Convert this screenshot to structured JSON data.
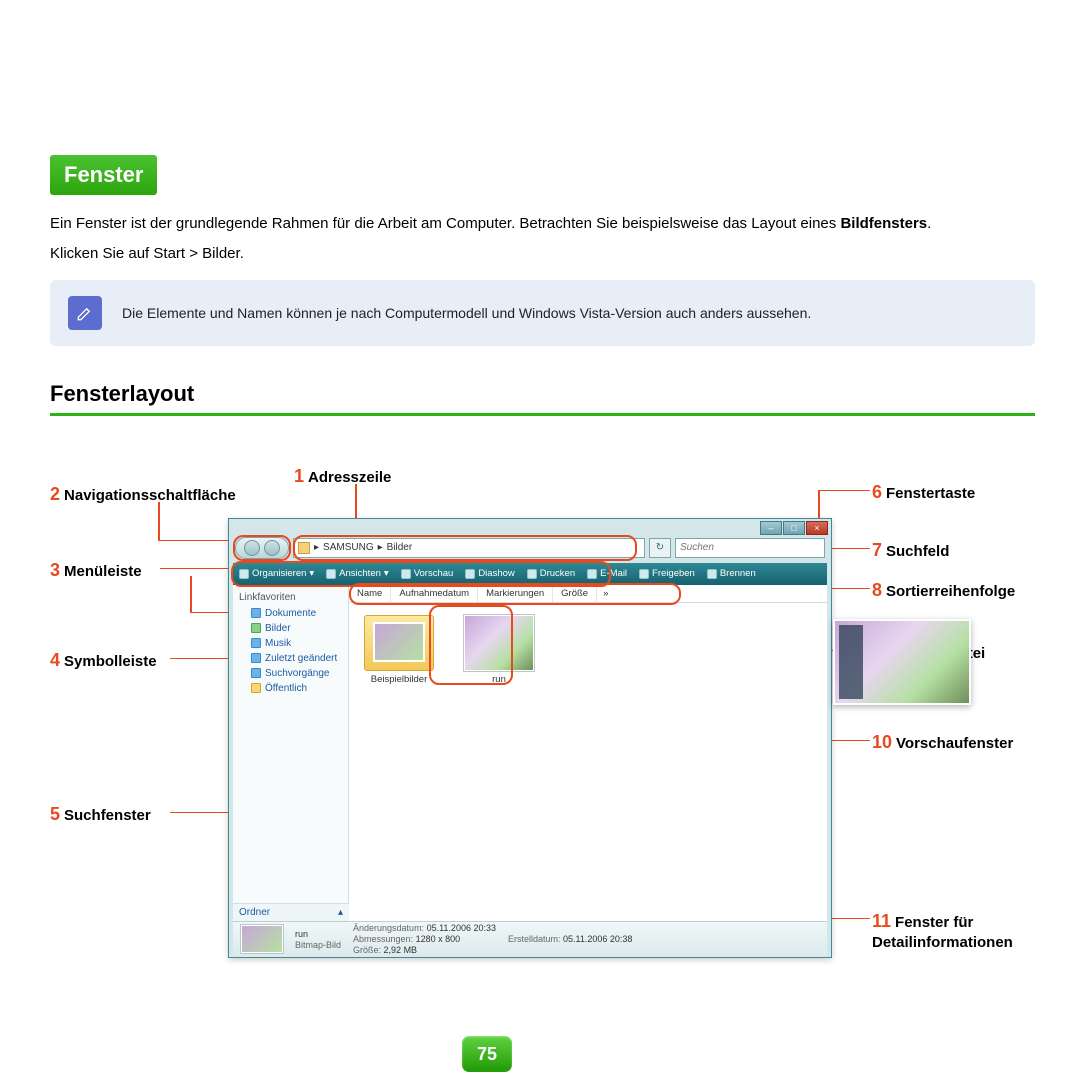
{
  "header": {
    "title": "Fenster"
  },
  "intro": {
    "line1a": "Ein Fenster ist der grundlegende Rahmen für die Arbeit am Computer. Betrachten Sie beispielsweise das Layout eines ",
    "line1b": "Bildfensters",
    "line1c": ".",
    "instruction_pre": "Klicken Sie auf ",
    "instruction_bold": "Start > Bilder",
    "instruction_post": "."
  },
  "note": "Die Elemente und Namen können je nach Computermodell und Windows Vista-Version auch anders aussehen.",
  "section_title": "Fensterlayout",
  "callouts": {
    "1": "Adresszeile",
    "2": "Navigationsschaltfläche",
    "3": "Menüleiste",
    "4": "Symbolleiste",
    "5": "Suchfenster",
    "6": "Fenstertaste",
    "7": "Suchfeld",
    "8": "Sortierreihenfolge",
    "9": "Ordner / Datei",
    "10": "Vorschaufenster",
    "11a": "Fenster für",
    "11b": "Detailinformationen"
  },
  "window": {
    "address": {
      "seg1": "SAMSUNG",
      "seg2": "Bilder",
      "sep": "▸"
    },
    "search_placeholder": "Suchen",
    "toolbar": [
      "Organisieren",
      "Ansichten",
      "Vorschau",
      "Diashow",
      "Drucken",
      "E-Mail",
      "Freigeben",
      "Brennen"
    ],
    "nav_head": "Linkfavoriten",
    "nav_items": [
      "Dokumente",
      "Bilder",
      "Musik",
      "Zuletzt geändert",
      "Suchvorgänge",
      "Öffentlich"
    ],
    "folders_label": "Ordner",
    "folders_caret": "▴",
    "sort_cols": [
      "Name",
      "Aufnahmedatum",
      "Markierungen",
      "Größe"
    ],
    "sort_more": "»",
    "items": {
      "folder_label": "Beispielbilder",
      "file_label": "run"
    },
    "details": {
      "name": "run",
      "type": "Bitmap-Bild",
      "mod_label": "Änderungsdatum:",
      "mod": "05.11.2006 20:33",
      "dim_label": "Abmessungen:",
      "dim": "1280 x 800",
      "size_label": "Größe:",
      "size": "2,92 MB",
      "created_label": "Erstelldatum:",
      "created": "05.11.2006 20:38"
    }
  },
  "page_number": "75"
}
